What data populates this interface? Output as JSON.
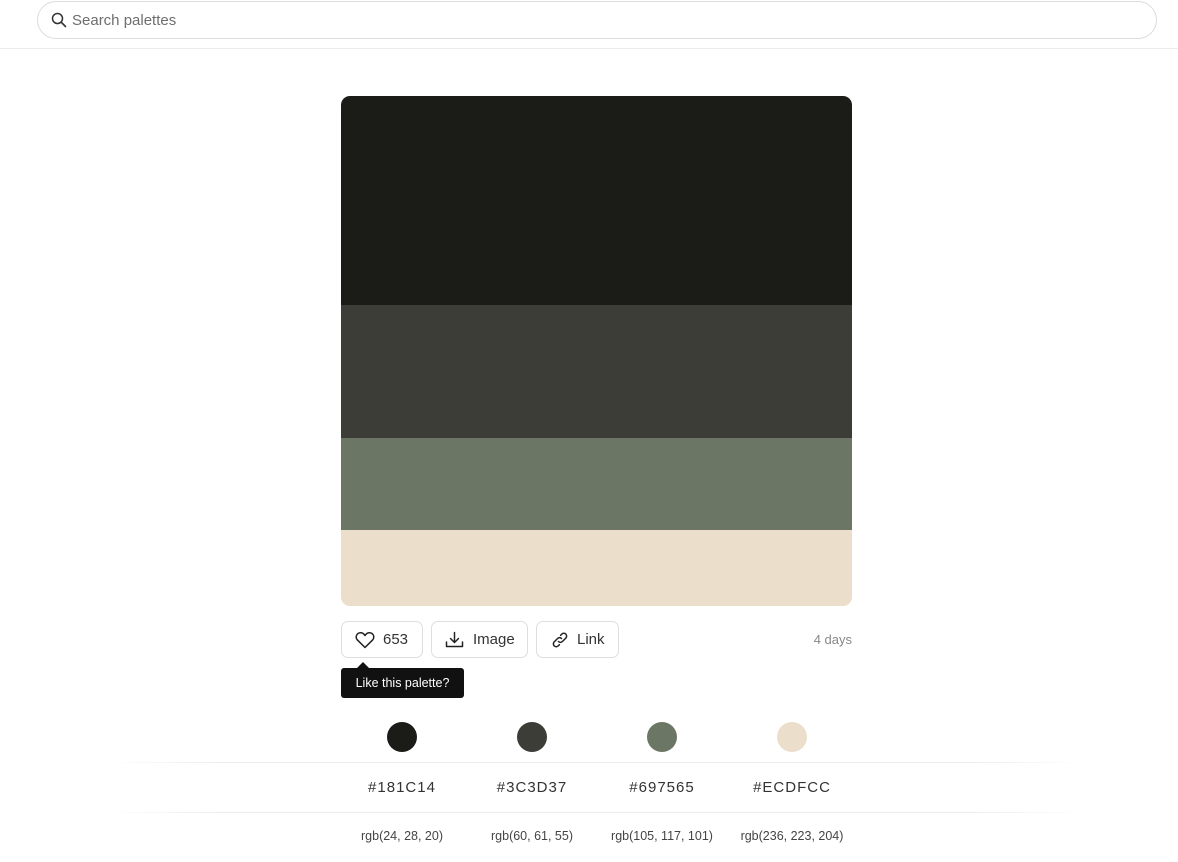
{
  "search": {
    "placeholder": "Search palettes",
    "value": ""
  },
  "palette": {
    "colors": [
      {
        "hex": "#181C14",
        "rgb": "rgb(24, 28, 20)"
      },
      {
        "hex": "#3C3D37",
        "rgb": "rgb(60, 61, 55)"
      },
      {
        "hex": "#697565",
        "rgb": "rgb(105, 117, 101)"
      },
      {
        "hex": "#ECDFCC",
        "rgb": "rgb(236, 223, 204)"
      }
    ]
  },
  "actions": {
    "likes": "653",
    "image_label": "Image",
    "link_label": "Link",
    "age": "4 days"
  },
  "tooltip": {
    "text": "Like this palette?"
  },
  "icons": {
    "search": "search-icon",
    "like": "heart-icon",
    "image": "download-icon",
    "link": "link-icon"
  }
}
